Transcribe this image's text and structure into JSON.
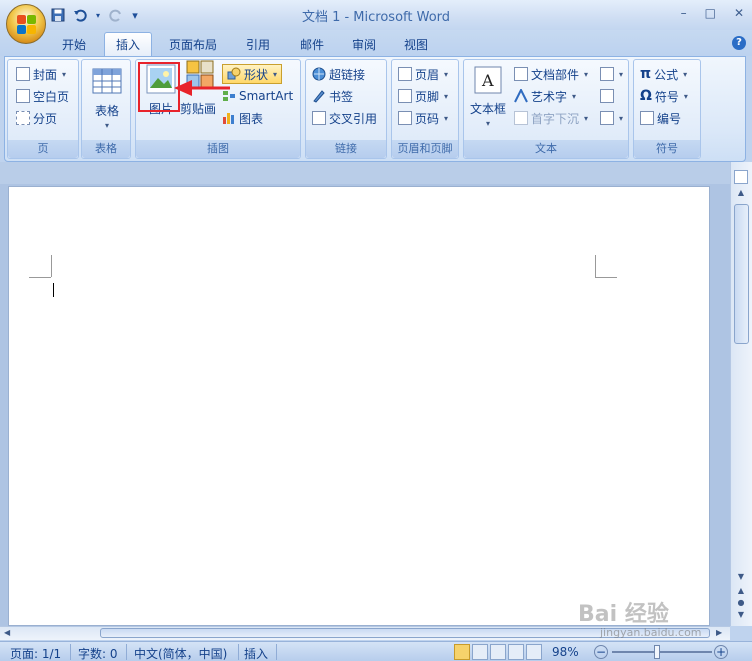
{
  "window": {
    "title": "文档 1 - Microsoft Word",
    "minimize": "–",
    "restore": "□",
    "close": "✕"
  },
  "tabs": [
    {
      "label": "开始"
    },
    {
      "label": "插入",
      "active": true
    },
    {
      "label": "页面布局"
    },
    {
      "label": "引用"
    },
    {
      "label": "邮件"
    },
    {
      "label": "审阅"
    },
    {
      "label": "视图"
    }
  ],
  "ribbon": {
    "pages": {
      "label": "页",
      "cover": "封面",
      "blank_page": "空白页",
      "page_break": "分页"
    },
    "tables": {
      "label": "表格",
      "table": "表格"
    },
    "illustrations": {
      "label": "插图",
      "picture": "图片",
      "clipart": "剪贴画",
      "shapes": "形状",
      "smartart": "SmartArt",
      "chart": "图表"
    },
    "links": {
      "label": "链接",
      "hyperlink": "超链接",
      "bookmark": "书签",
      "cross_ref": "交叉引用"
    },
    "header_footer": {
      "label": "页眉和页脚",
      "header": "页眉",
      "footer": "页脚",
      "page_number": "页码"
    },
    "text": {
      "label": "文本",
      "textbox": "文本框",
      "quick_parts": "文档部件",
      "wordart": "艺术字",
      "dropcap": "首字下沉"
    },
    "symbols": {
      "label": "符号",
      "equation": "公式",
      "symbol": "符号",
      "numbering": "编号"
    }
  },
  "statusbar": {
    "page": "页面: 1/1",
    "words": "字数: 0",
    "language": "中文(简体，中国)",
    "mode": "插入",
    "zoom": "98%"
  },
  "watermark": {
    "brand": "Bai 经验",
    "url": "jingyan.baidu.com"
  },
  "colors": {
    "highlight": "#e8232b",
    "arrow": "#e8232b",
    "ribbon_text": "#15428b"
  },
  "icons": {
    "save": "save-icon",
    "undo": "undo-icon",
    "redo": "redo-icon",
    "picture": "picture-icon",
    "equation": "pi-icon"
  }
}
